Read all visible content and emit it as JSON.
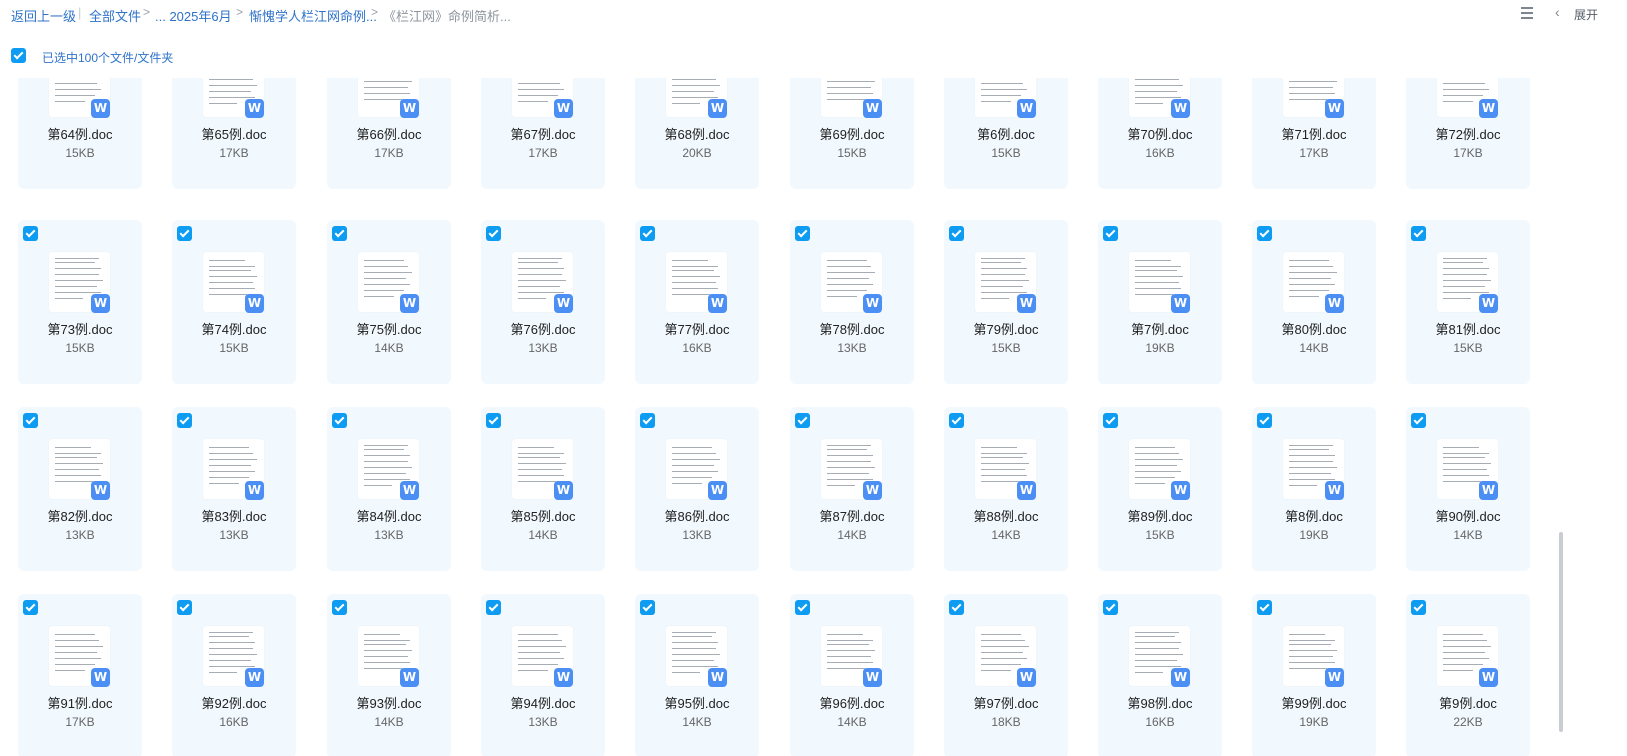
{
  "breadcrumb": {
    "back": "返回上一级",
    "all_files": "全部文件",
    "level1": "... 2025年6月",
    "level2": "惭愧学人栏江网命例...",
    "current": "《栏江网》命例简析..."
  },
  "header_right": {
    "expand": "展开"
  },
  "selection": {
    "label": "已选中100个文件/文件夹"
  },
  "grid": {
    "rows": [
      [
        {
          "name": "第64例.doc",
          "size": "15KB"
        },
        {
          "name": "第65例.doc",
          "size": "17KB"
        },
        {
          "name": "第66例.doc",
          "size": "17KB"
        },
        {
          "name": "第67例.doc",
          "size": "17KB"
        },
        {
          "name": "第68例.doc",
          "size": "20KB"
        },
        {
          "name": "第69例.doc",
          "size": "15KB"
        },
        {
          "name": "第6例.doc",
          "size": "15KB"
        },
        {
          "name": "第70例.doc",
          "size": "16KB"
        },
        {
          "name": "第71例.doc",
          "size": "17KB"
        },
        {
          "name": "第72例.doc",
          "size": "17KB"
        }
      ],
      [
        {
          "name": "第73例.doc",
          "size": "15KB"
        },
        {
          "name": "第74例.doc",
          "size": "15KB"
        },
        {
          "name": "第75例.doc",
          "size": "14KB"
        },
        {
          "name": "第76例.doc",
          "size": "13KB"
        },
        {
          "name": "第77例.doc",
          "size": "16KB"
        },
        {
          "name": "第78例.doc",
          "size": "13KB"
        },
        {
          "name": "第79例.doc",
          "size": "15KB"
        },
        {
          "name": "第7例.doc",
          "size": "19KB"
        },
        {
          "name": "第80例.doc",
          "size": "14KB"
        },
        {
          "name": "第81例.doc",
          "size": "15KB"
        }
      ],
      [
        {
          "name": "第82例.doc",
          "size": "13KB"
        },
        {
          "name": "第83例.doc",
          "size": "13KB"
        },
        {
          "name": "第84例.doc",
          "size": "13KB"
        },
        {
          "name": "第85例.doc",
          "size": "14KB"
        },
        {
          "name": "第86例.doc",
          "size": "13KB"
        },
        {
          "name": "第87例.doc",
          "size": "14KB"
        },
        {
          "name": "第88例.doc",
          "size": "14KB"
        },
        {
          "name": "第89例.doc",
          "size": "15KB"
        },
        {
          "name": "第8例.doc",
          "size": "19KB"
        },
        {
          "name": "第90例.doc",
          "size": "14KB"
        }
      ],
      [
        {
          "name": "第91例.doc",
          "size": "17KB"
        },
        {
          "name": "第92例.doc",
          "size": "16KB"
        },
        {
          "name": "第93例.doc",
          "size": "14KB"
        },
        {
          "name": "第94例.doc",
          "size": "13KB"
        },
        {
          "name": "第95例.doc",
          "size": "14KB"
        },
        {
          "name": "第96例.doc",
          "size": "14KB"
        },
        {
          "name": "第97例.doc",
          "size": "18KB"
        },
        {
          "name": "第98例.doc",
          "size": "16KB"
        },
        {
          "name": "第99例.doc",
          "size": "19KB"
        },
        {
          "name": "第9例.doc",
          "size": "22KB"
        }
      ]
    ]
  },
  "icons": {
    "file_badge": "wps-writer-icon",
    "badge_letter": "W",
    "checkbox": "checkbox-checked-icon",
    "list_view": "list-view-icon",
    "collapse": "chevron-left-icon"
  },
  "colors": {
    "accent": "#0e9cf2",
    "link": "#2f73c9",
    "tile_bg": "#f1f8fe",
    "badge": "#4b8ff5"
  }
}
